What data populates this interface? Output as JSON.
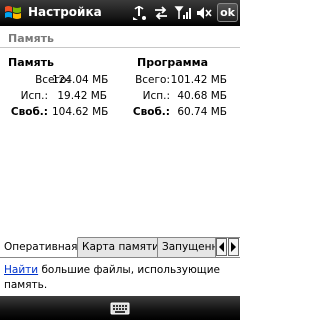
{
  "app": {
    "title": "Настройка",
    "ok_label": "ok"
  },
  "page": {
    "header": "Память"
  },
  "memory": {
    "heading": "Память",
    "rows": [
      {
        "label": "Всего:",
        "value": "124.04 МБ"
      },
      {
        "label": "Исп.:",
        "value": "19.42 МБ"
      },
      {
        "label": "Своб.:",
        "value": "104.62 МБ"
      }
    ]
  },
  "program": {
    "heading": "Программа",
    "rows": [
      {
        "label": "Всего:",
        "value": "101.42 МБ"
      },
      {
        "label": "Исп.:",
        "value": "40.68 МБ"
      },
      {
        "label": "Своб.:",
        "value": "60.74 МБ"
      }
    ]
  },
  "tabs": [
    {
      "label": "Оперативная",
      "active": true
    },
    {
      "label": "Карта памяти",
      "active": false
    },
    {
      "label": "Запущенные",
      "active": false
    }
  ],
  "hint": {
    "link": "Найти",
    "text": " большие файлы, использующие память."
  },
  "icons": [
    "windows-start-icon",
    "connectivity-icon",
    "sync-icon",
    "signal-icon",
    "volume-icon",
    "keyboard-icon",
    "left-arrow-icon",
    "right-arrow-icon"
  ]
}
